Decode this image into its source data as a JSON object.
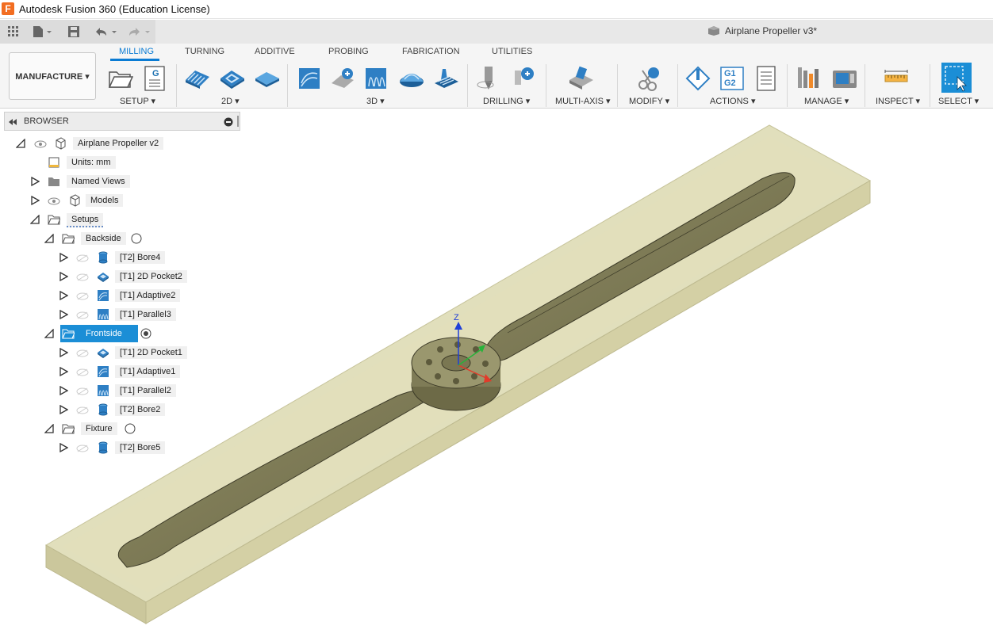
{
  "app": {
    "logo_letter": "F",
    "title": "Autodesk Fusion 360 (Education License)",
    "document_tab": "Airplane Propeller v3*"
  },
  "workspace": {
    "label": "MANUFACTURE ▾"
  },
  "tabs": [
    {
      "label": "MILLING",
      "active": true
    },
    {
      "label": "TURNING"
    },
    {
      "label": "ADDITIVE"
    },
    {
      "label": "PROBING"
    },
    {
      "label": "FABRICATION"
    },
    {
      "label": "UTILITIES"
    }
  ],
  "groups": {
    "setup": "SETUP ▾",
    "two_d": "2D ▾",
    "three_d": "3D ▾",
    "drilling": "DRILLING ▾",
    "multi_axis": "MULTI-AXIS ▾",
    "modify": "MODIFY ▾",
    "actions": "ACTIONS ▾",
    "manage": "MANAGE ▾",
    "inspect": "INSPECT ▾",
    "select": "SELECT ▾"
  },
  "actions_icon_text": {
    "line1": "G1",
    "line2": "G2"
  },
  "setup_icon_text": "G",
  "browser": {
    "title": "BROWSER",
    "root": "Airplane Propeller v2",
    "units": "Units: mm",
    "named_views": "Named Views",
    "models": "Models",
    "setups": "Setups",
    "backside": {
      "label": "Backside",
      "ops": [
        "[T2] Bore4",
        "[T1] 2D Pocket2",
        "[T1] Adaptive2",
        "[T1] Parallel3"
      ]
    },
    "frontside": {
      "label": "Frontside",
      "ops": [
        "[T1] 2D Pocket1",
        "[T1] Adaptive1",
        "[T1] Parallel2",
        "[T2] Bore2"
      ]
    },
    "fixture": {
      "label": "Fixture",
      "ops": [
        "[T2] Bore5"
      ]
    }
  },
  "viewport": {
    "axis_z_label": "Z"
  },
  "colors": {
    "accent": "#0a7bd3",
    "selection": "#1b8ed6",
    "stock": "#d8d5a8",
    "part": "#7d7a55"
  }
}
